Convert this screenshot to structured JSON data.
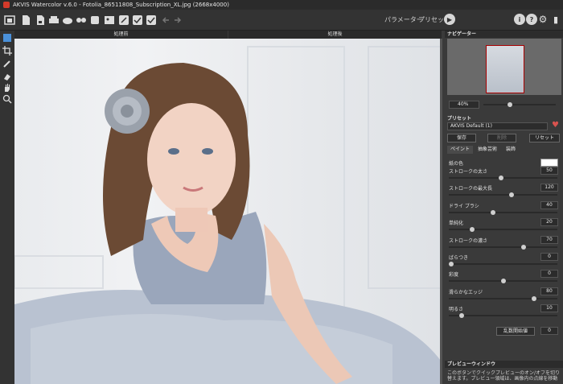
{
  "window": {
    "title": "AKVIS Watercolor v.6.0 - Fotolia_86511808_Subscription_XL.jpg (2668x4000)"
  },
  "toolbar": {
    "params_label": "パラメーター",
    "preset_label": "プリセット"
  },
  "canvas": {
    "tab_before": "処理前",
    "tab_after": "処理後"
  },
  "navigator": {
    "title": "ナビゲーター",
    "zoom": "40%"
  },
  "presets": {
    "title": "プリセット",
    "current": "AKVIS Default (1)",
    "save": "保存",
    "delete": "削除",
    "reset": "リセット"
  },
  "param_tabs": [
    "ペイント",
    "抽象芸術",
    "装飾"
  ],
  "params": [
    {
      "label": "紙の色",
      "value": "",
      "fill": null
    },
    {
      "label": "ストロークの太さ",
      "value": "50",
      "fill": 0.48
    },
    {
      "label": "ストロークの最大長",
      "value": "120",
      "fill": 0.58
    },
    {
      "label": "ドライ ブラシ",
      "value": "40",
      "fill": 0.4
    },
    {
      "label": "単純化",
      "value": "20",
      "fill": 0.2
    },
    {
      "label": "ストロークの濃さ",
      "value": "70",
      "fill": 0.7
    },
    {
      "label": "ばらつき",
      "value": "0",
      "fill": 0.0
    },
    {
      "label": "彩度",
      "value": "0",
      "fill": 0.5
    },
    {
      "label": "滑らかなエッジ",
      "value": "80",
      "fill": 0.8
    },
    {
      "label": "明るさ",
      "value": "10",
      "fill": 0.1
    }
  ],
  "random_seed": {
    "label": "乱数開始値",
    "value": "0"
  },
  "preview_window": {
    "title": "プレビューウィンドウ",
    "text": "このボタンでクイックプレビューのオン/オフを切り替えます。プレビュー領域は、画像内の点線を移動させることで"
  }
}
